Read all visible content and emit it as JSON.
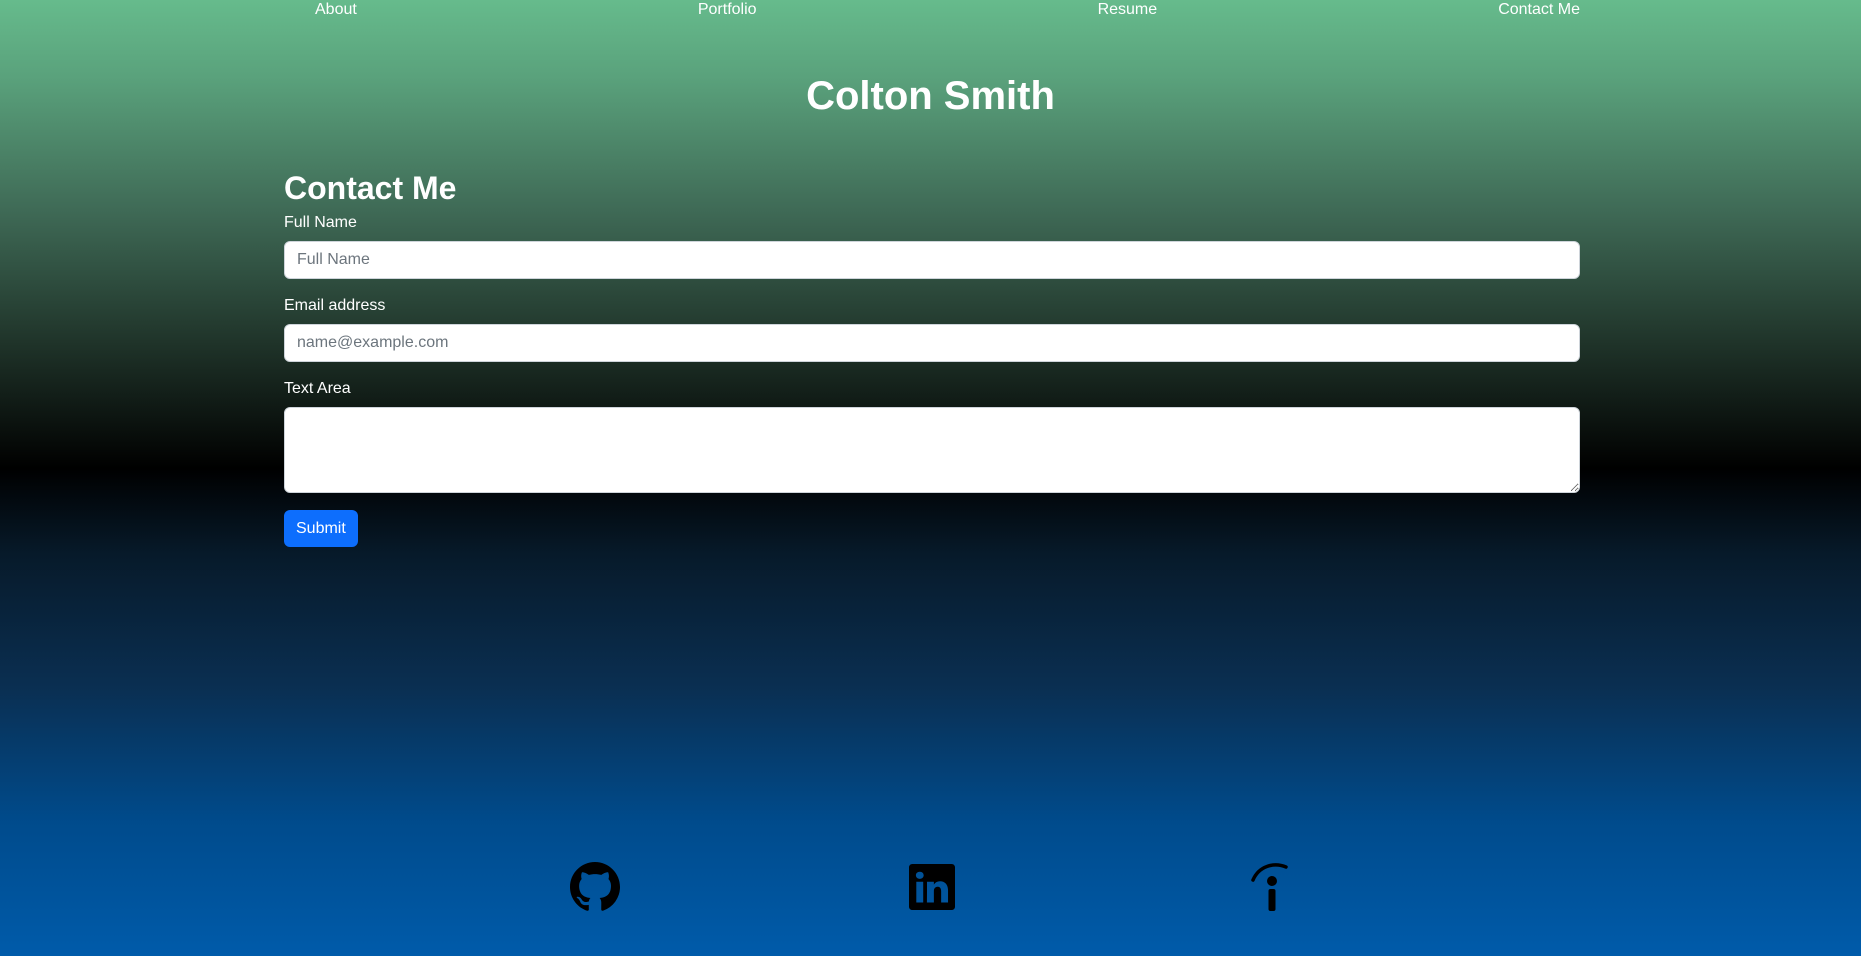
{
  "nav": {
    "items": [
      {
        "label": "About"
      },
      {
        "label": "Portfolio"
      },
      {
        "label": "Resume"
      },
      {
        "label": "Contact Me"
      }
    ]
  },
  "header": {
    "title": "Colton Smith"
  },
  "contact": {
    "heading": "Contact Me",
    "full_name": {
      "label": "Full Name",
      "placeholder": "Full Name",
      "value": ""
    },
    "email": {
      "label": "Email address",
      "placeholder": "name@example.com",
      "value": ""
    },
    "text_area": {
      "label": "Text Area",
      "value": ""
    },
    "submit_label": "Submit"
  },
  "footer": {
    "icons": [
      "github-icon",
      "linkedin-icon",
      "indeed-icon"
    ]
  },
  "colors": {
    "accent": "#0d6efd",
    "gradient_top": "#66bb8c",
    "gradient_middle": "#000000",
    "gradient_bottom": "#005baa"
  }
}
